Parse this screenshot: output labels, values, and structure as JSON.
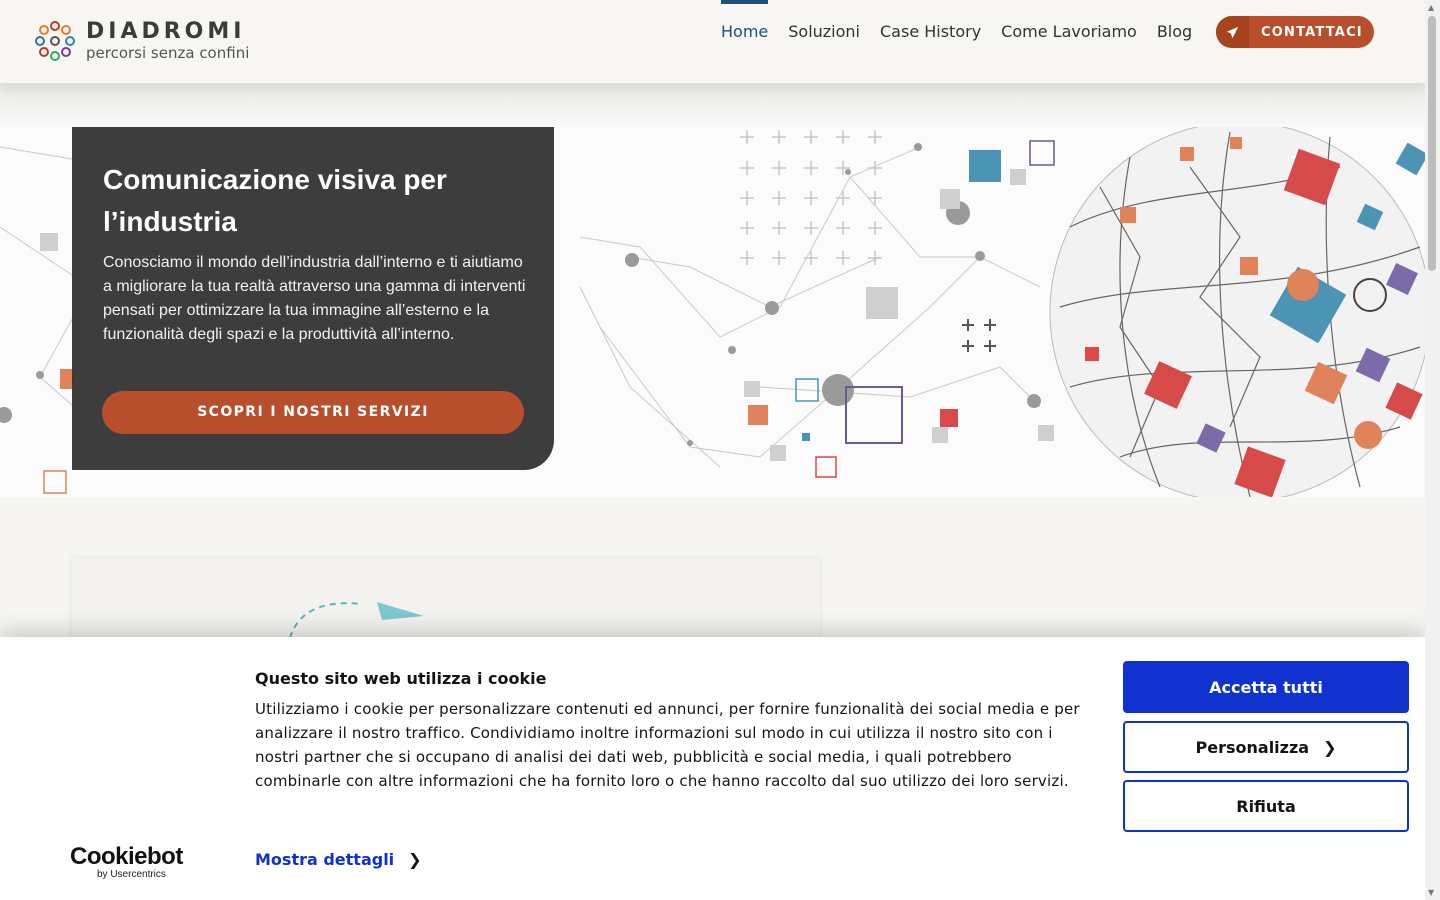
{
  "header": {
    "logo_name": "DIADROMI",
    "logo_tagline": "percorsi senza confini",
    "nav": [
      "Home",
      "Soluzioni",
      "Case History",
      "Come Lavoriamo",
      "Blog"
    ],
    "active_nav": "Home",
    "contact_label": "CONTATTACI"
  },
  "hero": {
    "title": "Comunicazione visiva per l’industria",
    "text": "Conosciamo il mondo dell’industria dall’interno e ti aiutiamo a migliorare la tua realtà attraverso una gamma di interventi pensati per ottimizzare la tua immagine all’esterno e la funzionalità degli spazi e la produttività all’interno.",
    "button_label": "SCOPRI I NOSTRI SERVIZI"
  },
  "cookie": {
    "brand_name": "Cookiebot",
    "brand_sub": "by Usercentrics",
    "title": "Questo sito web utilizza i cookie",
    "text": "Utilizziamo i cookie per personalizzare contenuti ed annunci, per fornire funzionalità dei social media e per analizzare il nostro traffico. Condividiamo inoltre informazioni sul modo in cui utilizza il nostro sito con i nostri partner che si occupano di analisi dei dati web, pubblicità e social media, i quali potrebbero combinarle con altre informazioni che ha fornito loro o che hanno raccolto dal suo utilizzo dei loro servizi.",
    "details_label": "Mostra dettagli",
    "accept_label": "Accetta tutti",
    "customize_label": "Personalizza",
    "reject_label": "Rifiuta"
  },
  "colors": {
    "brand_orange": "#b84e2c",
    "nav_active": "#1f4e79",
    "cookie_blue": "#1032cf",
    "hero_card": "#373737"
  },
  "icons": {
    "contact": "paper-plane-icon",
    "details": "chevron-right-icon",
    "customize": "chevron-right-icon"
  }
}
